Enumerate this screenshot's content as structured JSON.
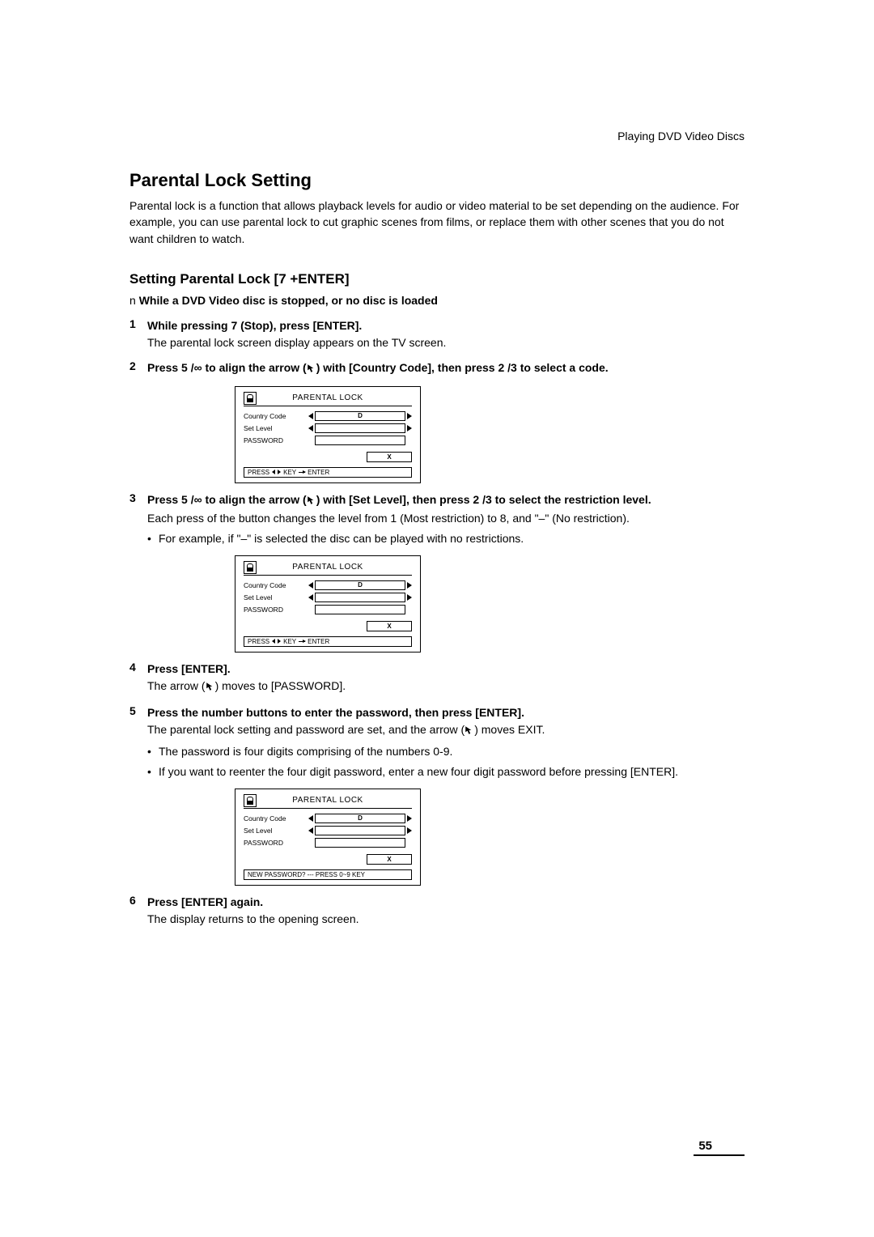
{
  "header": {
    "running": "Playing DVD Video Discs"
  },
  "title": "Parental Lock Setting",
  "intro": "Parental lock is a function that allows playback levels for audio or video material to be set depending on the audience. For example, you can use parental lock to cut graphic scenes from films, or replace them with other scenes that you do not want children to watch.",
  "subtitle": "Setting Parental Lock [7 +ENTER]",
  "precondition_prefix": "n",
  "precondition": "While a DVD Video disc is stopped, or no disc is loaded",
  "steps": {
    "s1": {
      "num": "1",
      "bold": "While pressing 7 (Stop), press [ENTER].",
      "body": "The parental lock screen display appears on the TV screen."
    },
    "s2": {
      "num": "2",
      "bold_a": "Press 5 /∞ to align the arrow (",
      "bold_b": ") with [Country Code], then press 2 /3  to select a code."
    },
    "s3": {
      "num": "3",
      "bold_a": "Press 5 /∞ to align the arrow (",
      "bold_b": ") with [Set Level], then press 2 /3  to select the restriction level.",
      "body": "Each press of the button changes the level from 1 (Most restriction) to 8, and \"–\" (No restriction).",
      "bullet": "For example, if \"–\" is selected the disc can be played with no restrictions."
    },
    "s4": {
      "num": "4",
      "bold": "Press [ENTER].",
      "body_a": "The arrow (",
      "body_b": ") moves to [PASSWORD]."
    },
    "s5": {
      "num": "5",
      "bold": "Press the number buttons to enter the password, then press [ENTER].",
      "body_a": "The parental lock setting and password are set, and the arrow (",
      "body_b": ") moves EXIT.",
      "bullet1": "The password is four digits comprising of the numbers 0-9.",
      "bullet2": "If you want to reenter the four digit password, enter a new four digit password before pressing [ENTER]."
    },
    "s6": {
      "num": "6",
      "bold": "Press [ENTER] again.",
      "body": "The display returns to the opening screen."
    }
  },
  "osd": {
    "title": "PARENTAL LOCK",
    "row1": "Country Code",
    "row2": "Set Level",
    "row3": "PASSWORD",
    "value_d": "D",
    "exit": "X",
    "footer_press": "PRESS",
    "footer_key": "KEY",
    "footer_enter": "ENTER",
    "footer_newpw": "NEW PASSWORD? --- PRESS 0~9 KEY"
  },
  "page_number": "55"
}
